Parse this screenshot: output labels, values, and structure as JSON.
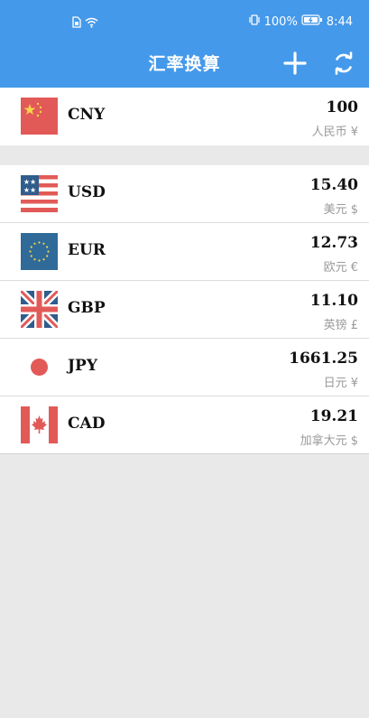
{
  "status_bar": {
    "battery": "100%",
    "time": "8:44"
  },
  "header": {
    "title": "汇率换算"
  },
  "base_currency": {
    "code": "CNY",
    "amount": "100",
    "name": "人民币 ¥",
    "flag": "china-flag-icon"
  },
  "currencies": [
    {
      "code": "USD",
      "amount": "15.40",
      "name": "美元 $",
      "flag": "usa-flag-icon"
    },
    {
      "code": "EUR",
      "amount": "12.73",
      "name": "欧元 €",
      "flag": "eu-flag-icon"
    },
    {
      "code": "GBP",
      "amount": "11.10",
      "name": "英镑 £",
      "flag": "uk-flag-icon"
    },
    {
      "code": "JPY",
      "amount": "1661.25",
      "name": "日元 ¥",
      "flag": "japan-flag-icon"
    },
    {
      "code": "CAD",
      "amount": "19.21",
      "name": "加拿大元 $",
      "flag": "canada-flag-icon"
    }
  ],
  "colors": {
    "header_bg": "#4599ea",
    "secondary_text": "#9a9a9a",
    "page_bg": "#e9e9e9"
  }
}
